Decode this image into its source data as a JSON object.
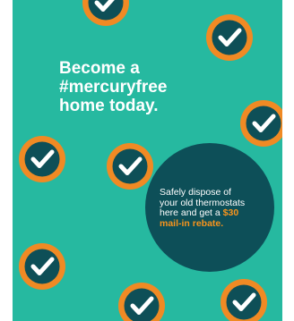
{
  "colors": {
    "background": "#26b9a0",
    "badge_ring": "#f08a24",
    "badge_fill": "#0e4f57",
    "check": "#ffffff",
    "circle": "#0d4f58",
    "highlight": "#f7941d"
  },
  "headline": {
    "line1": "Become a",
    "line2": "#mercuryfree",
    "line3": "home today."
  },
  "circle": {
    "line1": "Safely dispose of",
    "line2": "your old thermostats",
    "line3_pre": "here and get a ",
    "line3_highlight": "$30",
    "line4": "mail-in rebate."
  },
  "icon": "check-badge-icon"
}
